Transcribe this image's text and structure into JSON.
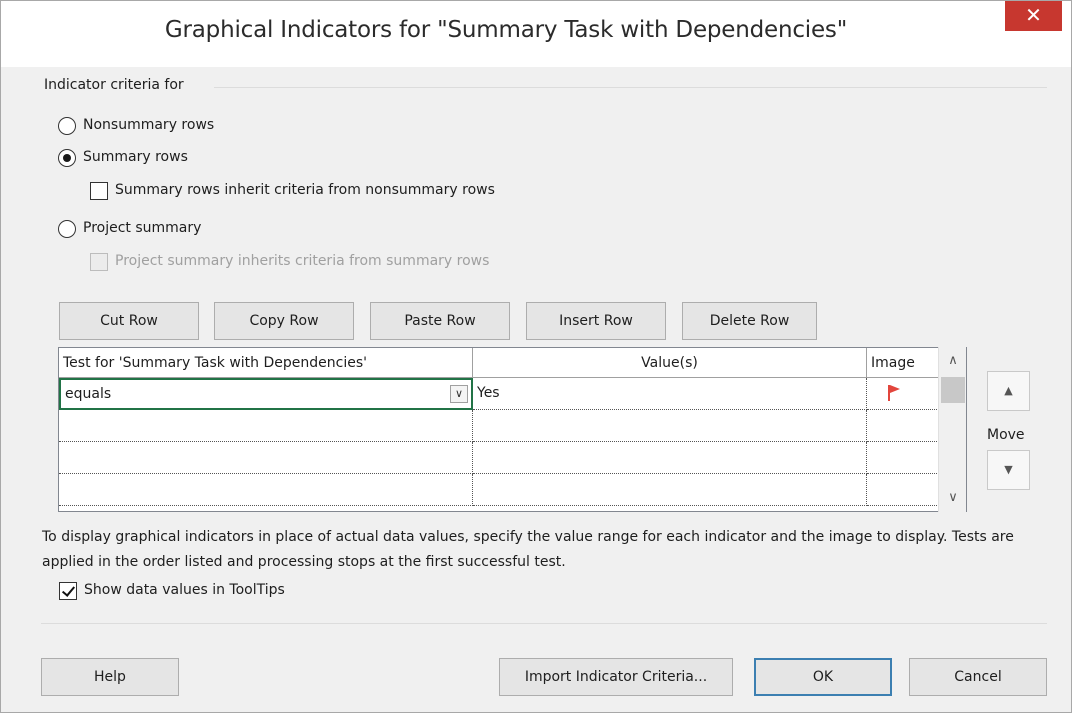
{
  "dialog": {
    "title": "Graphical Indicators for \"Summary Task with Dependencies\"",
    "close_glyph": "✕"
  },
  "criteria": {
    "group_label": "Indicator criteria for",
    "nonsummary": "Nonsummary rows",
    "summary": "Summary rows",
    "summary_inherit": "Summary rows inherit criteria from nonsummary rows",
    "project": "Project summary",
    "project_inherit": "Project summary inherits criteria from summary rows",
    "selected": "summary"
  },
  "toolbar": {
    "cut": "Cut Row",
    "copy": "Copy Row",
    "paste": "Paste Row",
    "insert": "Insert Row",
    "delete": "Delete Row"
  },
  "grid": {
    "headers": [
      "Test for 'Summary Task with Dependencies'",
      "Value(s)",
      "Image"
    ],
    "rows": [
      {
        "test": "equals",
        "value": "Yes",
        "image": "red-flag-icon"
      },
      {
        "test": "",
        "value": "",
        "image": ""
      },
      {
        "test": "",
        "value": "",
        "image": ""
      },
      {
        "test": "",
        "value": "",
        "image": ""
      }
    ],
    "flag_color": "#e2453c"
  },
  "move": {
    "label": "Move",
    "up_glyph": "▲",
    "down_glyph": "▼"
  },
  "note": "To display graphical indicators in place of actual data values, specify the value range for each indicator and the image to display.  Tests are applied in the order listed and processing stops at the first successful test.",
  "tooltips": {
    "label": "Show data values in ToolTips",
    "checked": true
  },
  "footer": {
    "help": "Help",
    "import": "Import Indicator Criteria...",
    "ok": "OK",
    "cancel": "Cancel"
  }
}
